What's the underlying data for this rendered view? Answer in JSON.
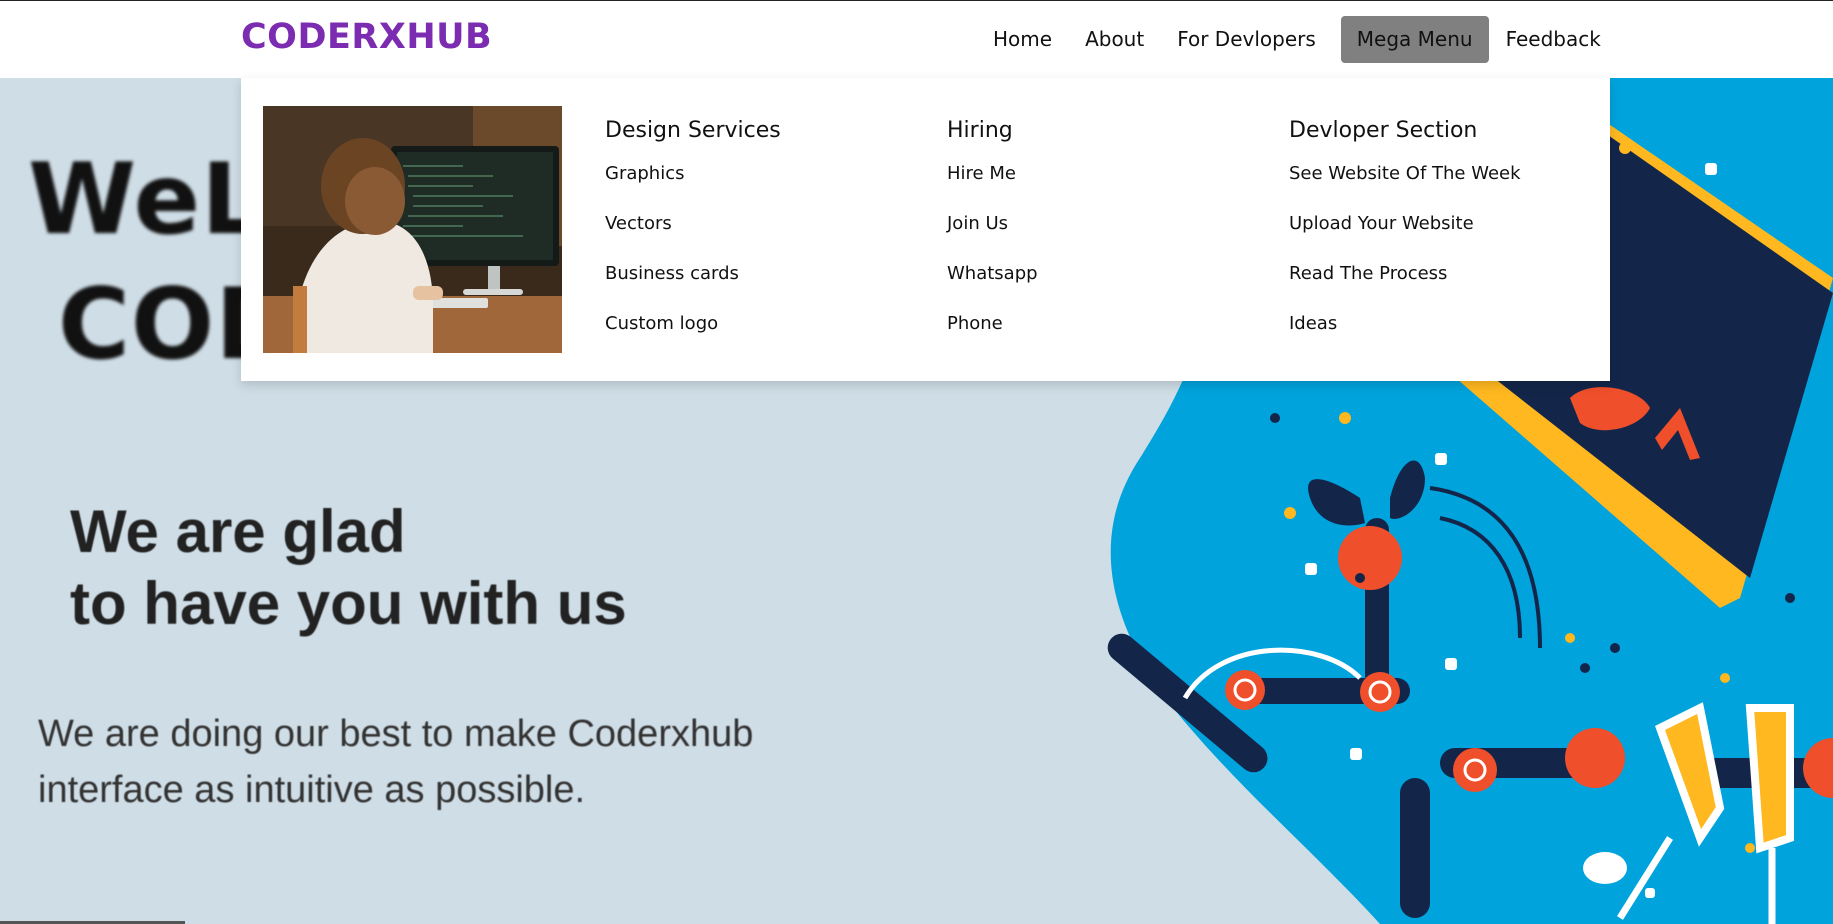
{
  "brand": "CODERXHUB",
  "nav": {
    "home": "Home",
    "about": "About",
    "developers": "For Devlopers",
    "mega": "Mega Menu",
    "feedback": "Feedback"
  },
  "mega_menu": {
    "photo_icon": "photo-child-at-computer",
    "columns": [
      {
        "title": "Design Services",
        "links": [
          "Graphics",
          "Vectors",
          "Business cards",
          "Custom logo"
        ]
      },
      {
        "title": "Hiring",
        "links": [
          "Hire Me",
          "Join Us",
          "Whatsapp",
          "Phone"
        ]
      },
      {
        "title": "Devloper Section",
        "links": [
          "See Website Of The Week",
          "Upload Your Website",
          "Read The Process",
          "Ideas"
        ]
      }
    ]
  },
  "hero": {
    "welcome_line1": "WeLcome to",
    "welcome_line2": "CODERXHUB",
    "title_line1": "We are glad",
    "title_line2": "to have you with us",
    "subtitle": "We are doing our best to make Coderxhub interface as intuitive as possible."
  },
  "colors": {
    "brand": "#7b2cb0",
    "hero_bg": "#cfdde6",
    "active_nav": "#808080",
    "blob": "#00a3dc",
    "navy": "#13264a",
    "accent_orange": "#ef4f2b",
    "accent_yellow": "#ffb81f"
  }
}
